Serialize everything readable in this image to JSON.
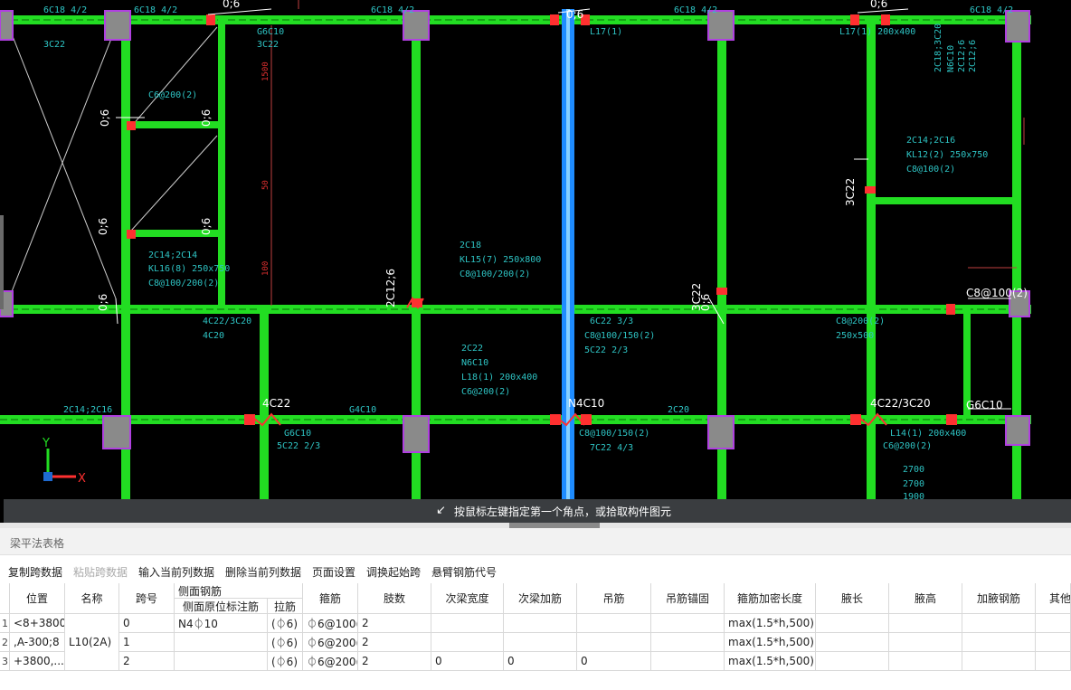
{
  "cad": {
    "status_message": "按鼠标左键指定第一个角点，或拾取构件图元",
    "axis": {
      "x_label": "X",
      "y_label": "Y"
    },
    "colors": {
      "beam": "#22dd22",
      "highlight_beam": "#1e8cff",
      "column_fill": "#8a8a8a",
      "column_border": "#b040e0",
      "rebar_mark": "#ff3030",
      "annotation": "#2ec4c4"
    },
    "annotations": [
      "6C18 4/2",
      "6C18 4/2",
      "6C18 4/2",
      "6C18 4/2",
      "6C18 4/2",
      "0;6",
      "0;6",
      "0;6",
      "0;6",
      "0;6",
      "0;6",
      "0;6",
      "0;6",
      "0;6",
      "3C22",
      "C8@100(2)",
      "G6C10",
      "3C22",
      "G6C10",
      "3C22",
      "3C22",
      "L17(1)",
      "L17(1) 200x400",
      "C6@200(2)",
      "2C14;2C14",
      "KL16(8) 250x750",
      "C8@100/200(2)",
      "2C18",
      "KL15(7) 250x800",
      "C8@100/200(2)",
      "2C22",
      "N6C10",
      "L18(1) 200x400",
      "C6@200(2)",
      "2C14;2C16",
      "KL12(2) 250x750",
      "C8@100(2)",
      "2C18;3C20",
      "N6C10",
      "2C12;6",
      "2C12;6",
      "2C12;6",
      "4C22",
      "N4C10",
      "4C22/3C20",
      "4C22/3C20",
      "4C20",
      "G4C10",
      "2C20",
      "C8@200(2)",
      "250x500",
      "6C22 3/3",
      "C8@100/150(2)",
      "5C22 2/3",
      "G6C10",
      "5C22 2/3",
      "C8@100/150(2)",
      "7C22 4/3",
      "L14(1) 200x400",
      "C6@200(2)",
      "2C14;2C16",
      "2700",
      "2700",
      "1900",
      "1500",
      "50",
      "100"
    ]
  },
  "panel": {
    "title": "梁平法表格",
    "toolbar": [
      {
        "label": "复制跨数据",
        "enabled": true
      },
      {
        "label": "粘贴跨数据",
        "enabled": false
      },
      {
        "label": "输入当前列数据",
        "enabled": true
      },
      {
        "label": "删除当前列数据",
        "enabled": true
      },
      {
        "label": "页面设置",
        "enabled": true
      },
      {
        "label": "调换起始跨",
        "enabled": true
      },
      {
        "label": "悬臂钢筋代号",
        "enabled": true
      }
    ],
    "columns": {
      "position": "位置",
      "name": "名称",
      "span": "跨号",
      "side_rebar_group": "侧面钢筋",
      "side_rebar_mark": "侧面原位标注筋",
      "tie_bar": "拉筋",
      "stirrup": "箍筋",
      "leg_count": "肢数",
      "secondary_beam_width": "次梁宽度",
      "secondary_beam_rebar": "次梁加筋",
      "hanger": "吊筋",
      "hanger_anchor": "吊筋锚固",
      "stirrup_dense_length": "箍筋加密长度",
      "haunch_length": "腋长",
      "haunch_height": "腋高",
      "haunch_rebar": "加腋钢筋",
      "other": "其他"
    },
    "rows": [
      {
        "idx": "1",
        "position": "<8+3800",
        "span": "0",
        "side_rebar_mark": "N4⏀10",
        "tie_bar": "(⏀6)",
        "stirrup": "⏀6@100(",
        "leg_count": "2",
        "secondary_beam_width": "",
        "secondary_beam_rebar": "",
        "hanger": "",
        "stirrup_dense_length": "max(1.5*h,500)"
      },
      {
        "idx": "2",
        "position": ",A-300;8",
        "span": "1",
        "side_rebar_mark": "",
        "tie_bar": "(⏀6)",
        "stirrup": "⏀6@200(",
        "leg_count": "2",
        "secondary_beam_width": "",
        "secondary_beam_rebar": "",
        "hanger": "",
        "stirrup_dense_length": "max(1.5*h,500)"
      },
      {
        "idx": "3",
        "position": "+3800,...",
        "span": "2",
        "side_rebar_mark": "",
        "tie_bar": "(⏀6)",
        "stirrup": "⏀6@200(",
        "leg_count": "2",
        "secondary_beam_width": "0",
        "secondary_beam_rebar": "0",
        "hanger": "0",
        "stirrup_dense_length": "max(1.5*h,500)"
      }
    ],
    "beam_name": "L10(2A)"
  }
}
